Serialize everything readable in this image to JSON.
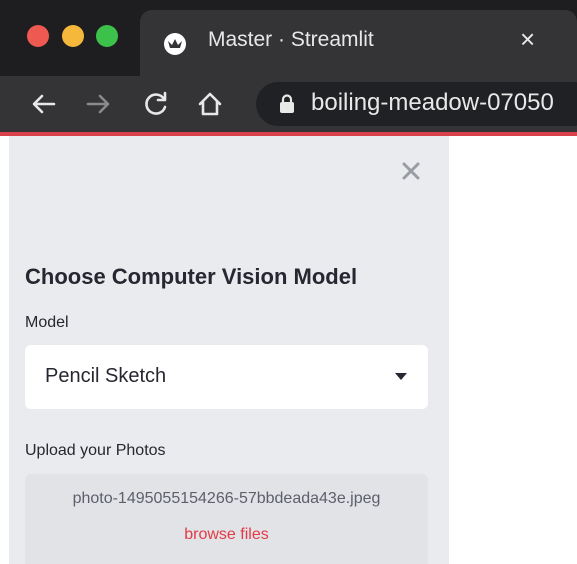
{
  "browser": {
    "tab_title": "Master · Streamlit",
    "tab_close": "×",
    "url": "boiling-meadow-07050",
    "favicon_icon": "streamlit-crown-icon",
    "nav_icons": [
      "back-arrow-icon",
      "forward-arrow-icon",
      "reload-icon",
      "home-icon",
      "lock-icon"
    ],
    "accent_line_color": "#d9414a"
  },
  "sidebar": {
    "close_icon": "close-icon",
    "heading": "Choose Computer Vision Model",
    "model_label": "Model",
    "model_select": {
      "selected": "Pencil Sketch"
    },
    "upload_label": "Upload your Photos",
    "uploader": {
      "file_name": "photo-1495055154266-57bbdeada43e.jpeg",
      "browse_label": "browse files"
    }
  }
}
